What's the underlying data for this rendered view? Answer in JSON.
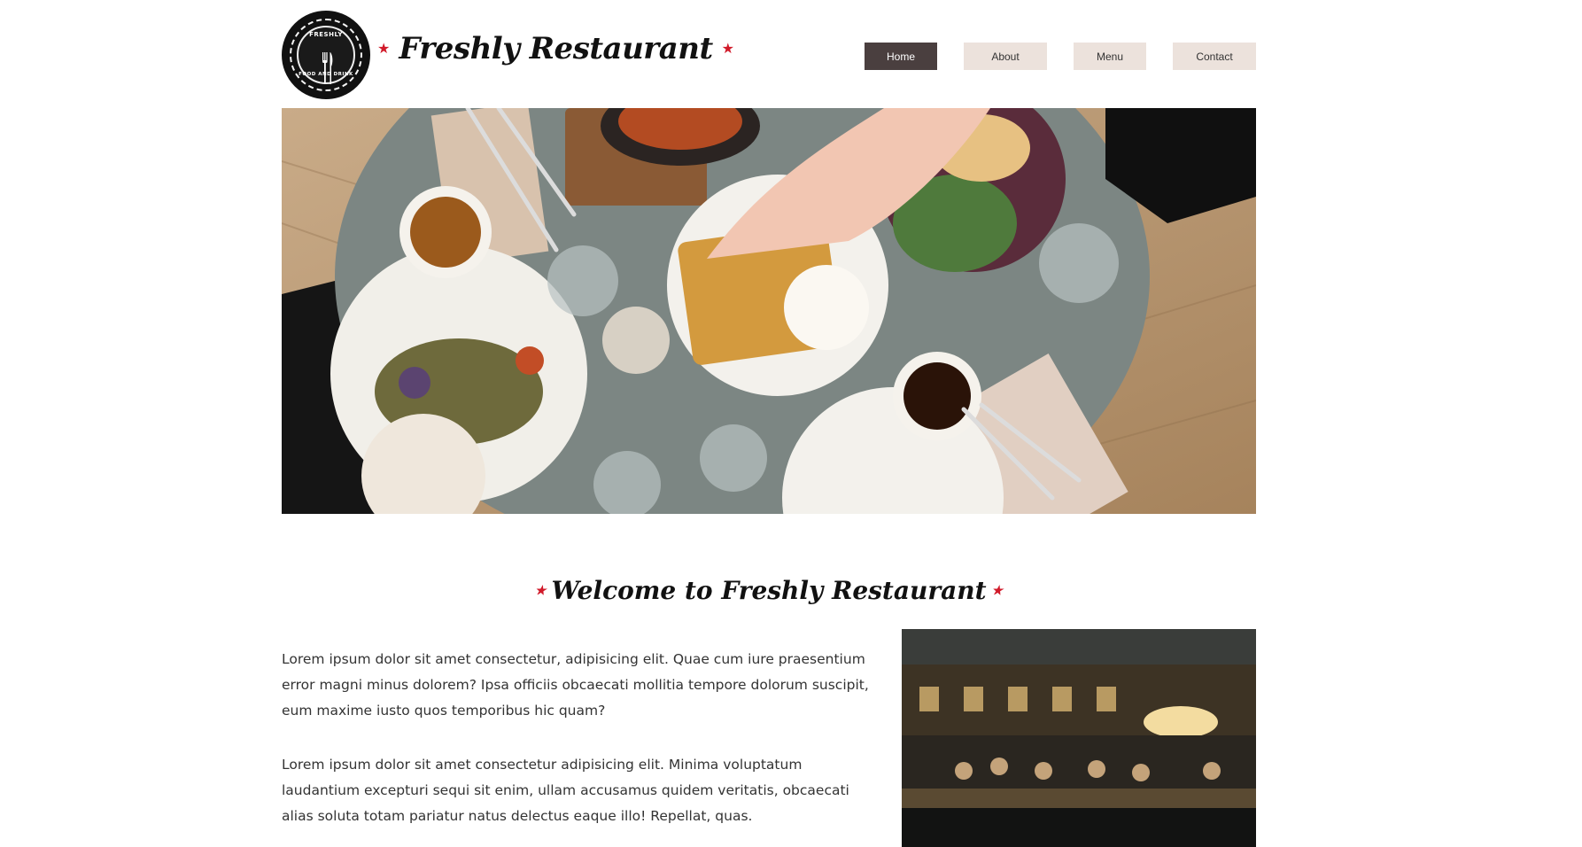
{
  "header": {
    "logo": {
      "top_text": "FRESHLY",
      "bottom_text": "FOOD AND DRINK",
      "icon": "fork-knife-icon"
    },
    "brand_title": "Freshly Restaurant",
    "star_glyph": "★"
  },
  "nav": {
    "items": [
      {
        "label": "Home",
        "active": true
      },
      {
        "label": "About",
        "active": false
      },
      {
        "label": "Menu",
        "active": false
      },
      {
        "label": "Contact",
        "active": false
      }
    ]
  },
  "welcome": {
    "title": "Welcome to Freshly Restaurant",
    "paragraphs": [
      "Lorem ipsum dolor sit amet consectetur, adipisicing elit. Quae cum iure praesentium error magni minus dolorem? Ipsa officiis obcaecati mollitia tempore dolorum suscipit, eum maxime iusto quos temporibus hic quam?",
      "Lorem ipsum dolor sit amet consectetur adipisicing elit. Minima voluptatum laudantium excepturi sequi sit enim, ullam accusamus quidem veritatis, obcaecati alias soluta totam pariatur natus delectus eaque illo! Repellat, quas."
    ]
  },
  "colors": {
    "accent_star": "#d11a2a",
    "nav_active_bg": "#4a3f3f",
    "nav_bg": "#ece2dc"
  }
}
